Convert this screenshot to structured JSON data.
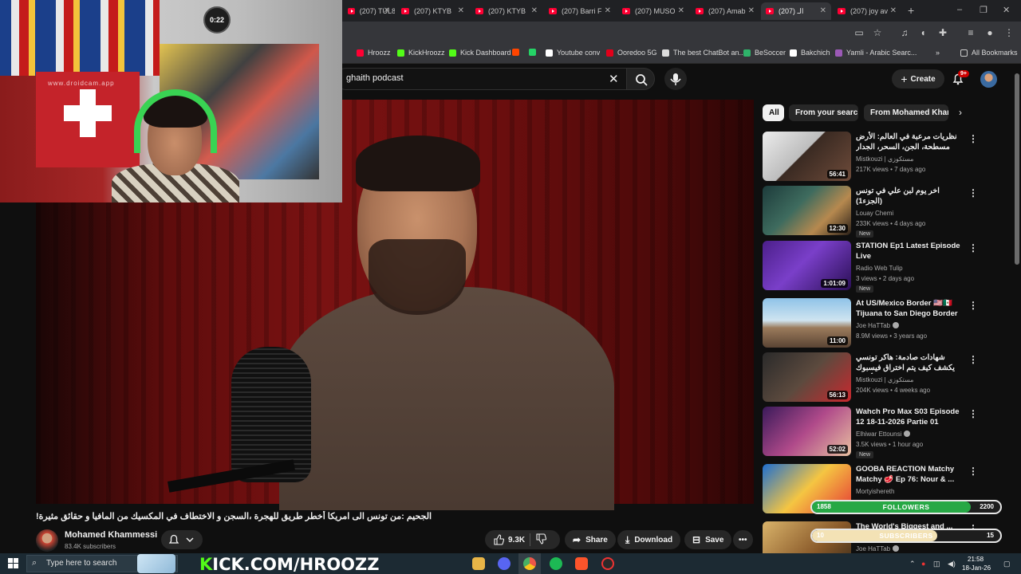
{
  "browser": {
    "tabs": [
      {
        "label": "(207) TUL8T"
      },
      {
        "label": "(207) KTYB"
      },
      {
        "label": "(207) KTYB"
      },
      {
        "label": "(207) Barri F"
      },
      {
        "label": "(207) MUSO"
      },
      {
        "label": "(207) Amab"
      },
      {
        "label": "(207) الـ",
        "active": true
      },
      {
        "label": "(207) joy av"
      }
    ],
    "new_tab": "+",
    "bookmarks": [
      {
        "label": "Hroozz",
        "color": "#ff0033"
      },
      {
        "label": "KickHroozz",
        "color": "#53fc18"
      },
      {
        "label": "Kick Dashboard",
        "color": "#53fc18"
      },
      {
        "label": "",
        "color": "#ff4500"
      },
      {
        "label": "",
        "color": "#25d366"
      },
      {
        "label": "Youtube conv",
        "color": "#ffffff"
      },
      {
        "label": "Ooredoo 5G",
        "color": "#e2001a"
      },
      {
        "label": "The best ChatBot an...",
        "color": "#dddddd"
      },
      {
        "label": "BeSoccer",
        "color": "#2fb36a"
      },
      {
        "label": "Bakchich",
        "color": "#ffffff"
      },
      {
        "label": "Yamli - Arabic Searc...",
        "color": "#9b59b6"
      }
    ],
    "bookmarks_more": "»",
    "all_bookmarks": "All Bookmarks"
  },
  "youtube": {
    "search_query": "ghaith podcast",
    "create_label": "Create",
    "notif_count": "9+",
    "chips": [
      {
        "label": "All",
        "active": true
      },
      {
        "label": "From your search"
      },
      {
        "label": "From Mohamed Khamm"
      }
    ],
    "video": {
      "title": "!الجحيم :من تونس الى امريكا أخطر طريق للهجرة ،السجن و الاختطاف في المكسيك من المافيا و حقائق مثيرة",
      "channel": "Mohamed Khammessi",
      "subscribers": "83.4K subscribers",
      "likes": "9.3K",
      "share_label": "Share",
      "download_label": "Download",
      "save_label": "Save"
    },
    "recommendations": [
      {
        "title": "نظريات مرعبة في العالم: الأرض مسطحة، الجن، السحر، الجدار الجليدي ،الماسونية",
        "channel": "Mistkouzi | مستكوزي",
        "meta": "217K views • 7 days ago",
        "duration": "56:41",
        "verified": false,
        "new": false,
        "thumb": "linear-gradient(135deg,#ececec 0%,#bdbdbd 45%,#3a2a22 46%,#6e4b3a 100%)"
      },
      {
        "title": "اخر يوم لبن علي في تونس (الجزء1)",
        "channel": "Louay Chemi",
        "meta": "233K views • 4 days ago",
        "duration": "12:30",
        "verified": false,
        "new": true,
        "thumb": "linear-gradient(135deg,#1d3b3b 0%,#3e6b5e 40%,#b6894f 70%,#2a2018 100%)"
      },
      {
        "title": "STATION Ep1 Latest Episode Live",
        "channel": "Radio Web Tulip",
        "meta": "3 views • 2 days ago",
        "duration": "1:01:09",
        "verified": false,
        "new": true,
        "thumb": "linear-gradient(135deg,#4b1f8a 0%,#7a3fc9 45%,#2a0f55 100%)"
      },
      {
        "title": "At US/Mexico Border 🇺🇸🇲🇽 Tijuana to San Diego Border ...",
        "channel": "Joe HaTTab",
        "meta": "8.9M views • 3 years ago",
        "duration": "11:00",
        "verified": true,
        "new": false,
        "thumb": "linear-gradient(180deg,#8fc3e8 0%,#cfe4f0 45%,#9b7b5c 60%,#5a4434 100%)"
      },
      {
        "title": "شهادات صادمة: هاكر تونسي يكشف كيف يتم اختراق فيسبوك والانستغرام وسرقة الأموال ...",
        "channel": "Mistkouzi | مستكوزي",
        "meta": "204K views • 4 weeks ago",
        "duration": "56:13",
        "verified": false,
        "new": false,
        "thumb": "linear-gradient(135deg,#2a2a2a 0%,#5c4a3e 50%,#c9282e 100%)"
      },
      {
        "title": "Wahch Pro Max S03 Episode 12 18-11-2026 Partie 01",
        "channel": "Elhiwar Ettounsi",
        "meta": "3.5K views • 1 hour ago",
        "duration": "52:02",
        "verified": true,
        "new": true,
        "thumb": "linear-gradient(135deg,#3a1a5a 0%,#b04a8a 50%,#e8c0a0 100%)"
      },
      {
        "title": "GOOBA REACTION Matchy Matchy 🥩 Ep 76: Nour & ...",
        "channel": "Mortyishereth",
        "meta": "",
        "duration": "",
        "verified": false,
        "new": false,
        "thumb": "linear-gradient(135deg,#1e6fd0 0%,#f5c542 50%,#e53935 100%)"
      },
      {
        "title": "The World's Biggest and ... Things: El ...",
        "channel": "Joe HaTTab",
        "meta": "",
        "duration": "",
        "verified": true,
        "new": false,
        "thumb": "linear-gradient(135deg,#d9b36a 0%,#8a5a2a 60%,#3a2a1a 100%)"
      }
    ]
  },
  "overlays": {
    "followers": {
      "label": "FOLLOWERS",
      "current": "1858",
      "goal": "2200",
      "progress": 0.845,
      "color": "#27a845"
    },
    "subscribers": {
      "label": "SUBSCRIBERS",
      "current": "10",
      "goal": "15",
      "progress": 0.667,
      "color": "#f3e2b5"
    },
    "kick_banner_k": "K",
    "kick_banner_rest": "ICK.COM/HROOZZ",
    "webcam_watermark": "www.droidcam.app",
    "clock_display": "0:22"
  },
  "taskbar": {
    "search_placeholder": "Type here to search",
    "time": "21:58",
    "date": "18-Jan-26"
  }
}
